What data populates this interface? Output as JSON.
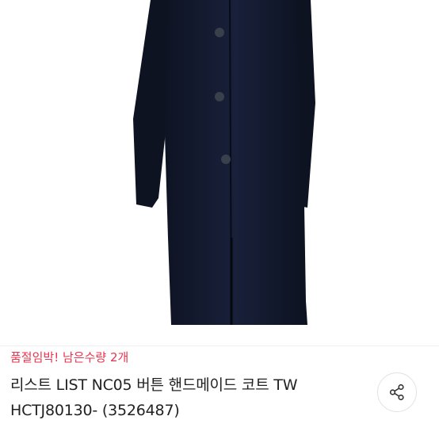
{
  "product": {
    "image_icon": "coat-photo",
    "coat_color": "#141a2c",
    "stock": {
      "status": "품절임박!",
      "remaining": "남은수량 2개",
      "color": "#e8344e"
    },
    "title_line1": "리스트 LIST NC05 버튼 핸드메이드 코트 TW",
    "title_line2": "HCTJ80130- (3526487)"
  },
  "actions": {
    "share_icon": "share-icon"
  }
}
